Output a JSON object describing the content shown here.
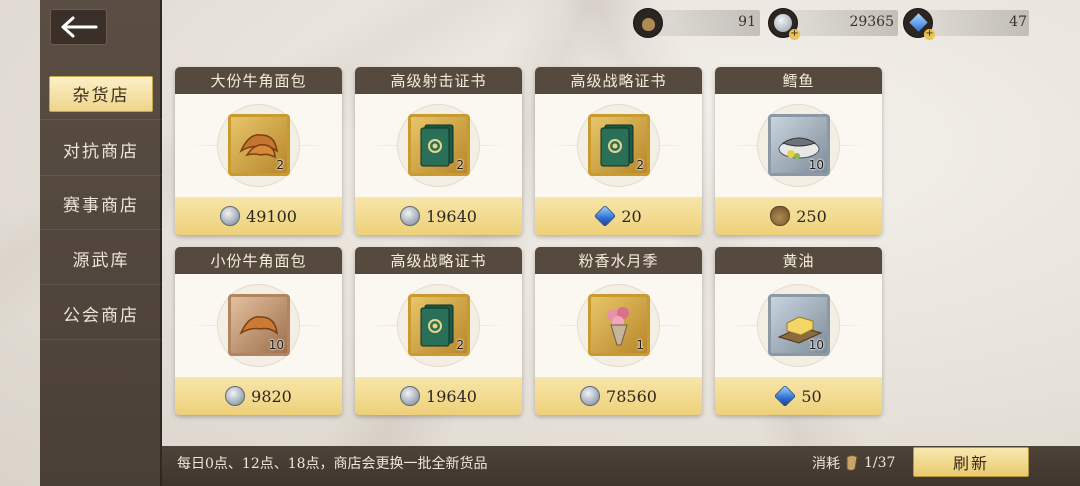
{
  "sidebar": {
    "items": [
      {
        "label": "杂货店",
        "active": true
      },
      {
        "label": "对抗商店",
        "active": false
      },
      {
        "label": "赛事商店",
        "active": false
      },
      {
        "label": "源武库",
        "active": false
      },
      {
        "label": "公会商店",
        "active": false
      }
    ]
  },
  "currencies": [
    {
      "icon": "coin-bag-icon",
      "value": "91"
    },
    {
      "icon": "silver-coin-icon",
      "value": "29365"
    },
    {
      "icon": "blue-gem-icon",
      "value": "47"
    }
  ],
  "shop_items": [
    {
      "name": "大份牛角面包",
      "qty": "2",
      "price": "49100",
      "currency": "silver-coin-icon",
      "item_icon": "croissant-icon",
      "frame": "gold"
    },
    {
      "name": "高级射击证书",
      "qty": "2",
      "price": "19640",
      "currency": "silver-coin-icon",
      "item_icon": "certificate-icon",
      "frame": "gold"
    },
    {
      "name": "高级战略证书",
      "qty": "2",
      "price": "20",
      "currency": "blue-gem-icon",
      "item_icon": "certificate-icon",
      "frame": "gold"
    },
    {
      "name": "鳕鱼",
      "qty": "10",
      "price": "250",
      "currency": "coin-bag-icon",
      "item_icon": "fish-icon",
      "frame": "silver"
    },
    {
      "name": "小份牛角面包",
      "qty": "10",
      "price": "9820",
      "currency": "silver-coin-icon",
      "item_icon": "croissant-icon",
      "frame": "bronze"
    },
    {
      "name": "高级战略证书",
      "qty": "2",
      "price": "19640",
      "currency": "silver-coin-icon",
      "item_icon": "certificate-icon",
      "frame": "gold"
    },
    {
      "name": "粉香水月季",
      "qty": "1",
      "price": "78560",
      "currency": "silver-coin-icon",
      "item_icon": "rose-bouquet-icon",
      "frame": "gold"
    },
    {
      "name": "黄油",
      "qty": "10",
      "price": "50",
      "currency": "blue-gem-icon",
      "item_icon": "butter-icon",
      "frame": "silver"
    }
  ],
  "footer": {
    "notice": "每日0点、12点、18点，商店会更换一批全新货品",
    "consume_label": "消耗",
    "consume_value": "1/37",
    "refresh_label": "刷新"
  }
}
